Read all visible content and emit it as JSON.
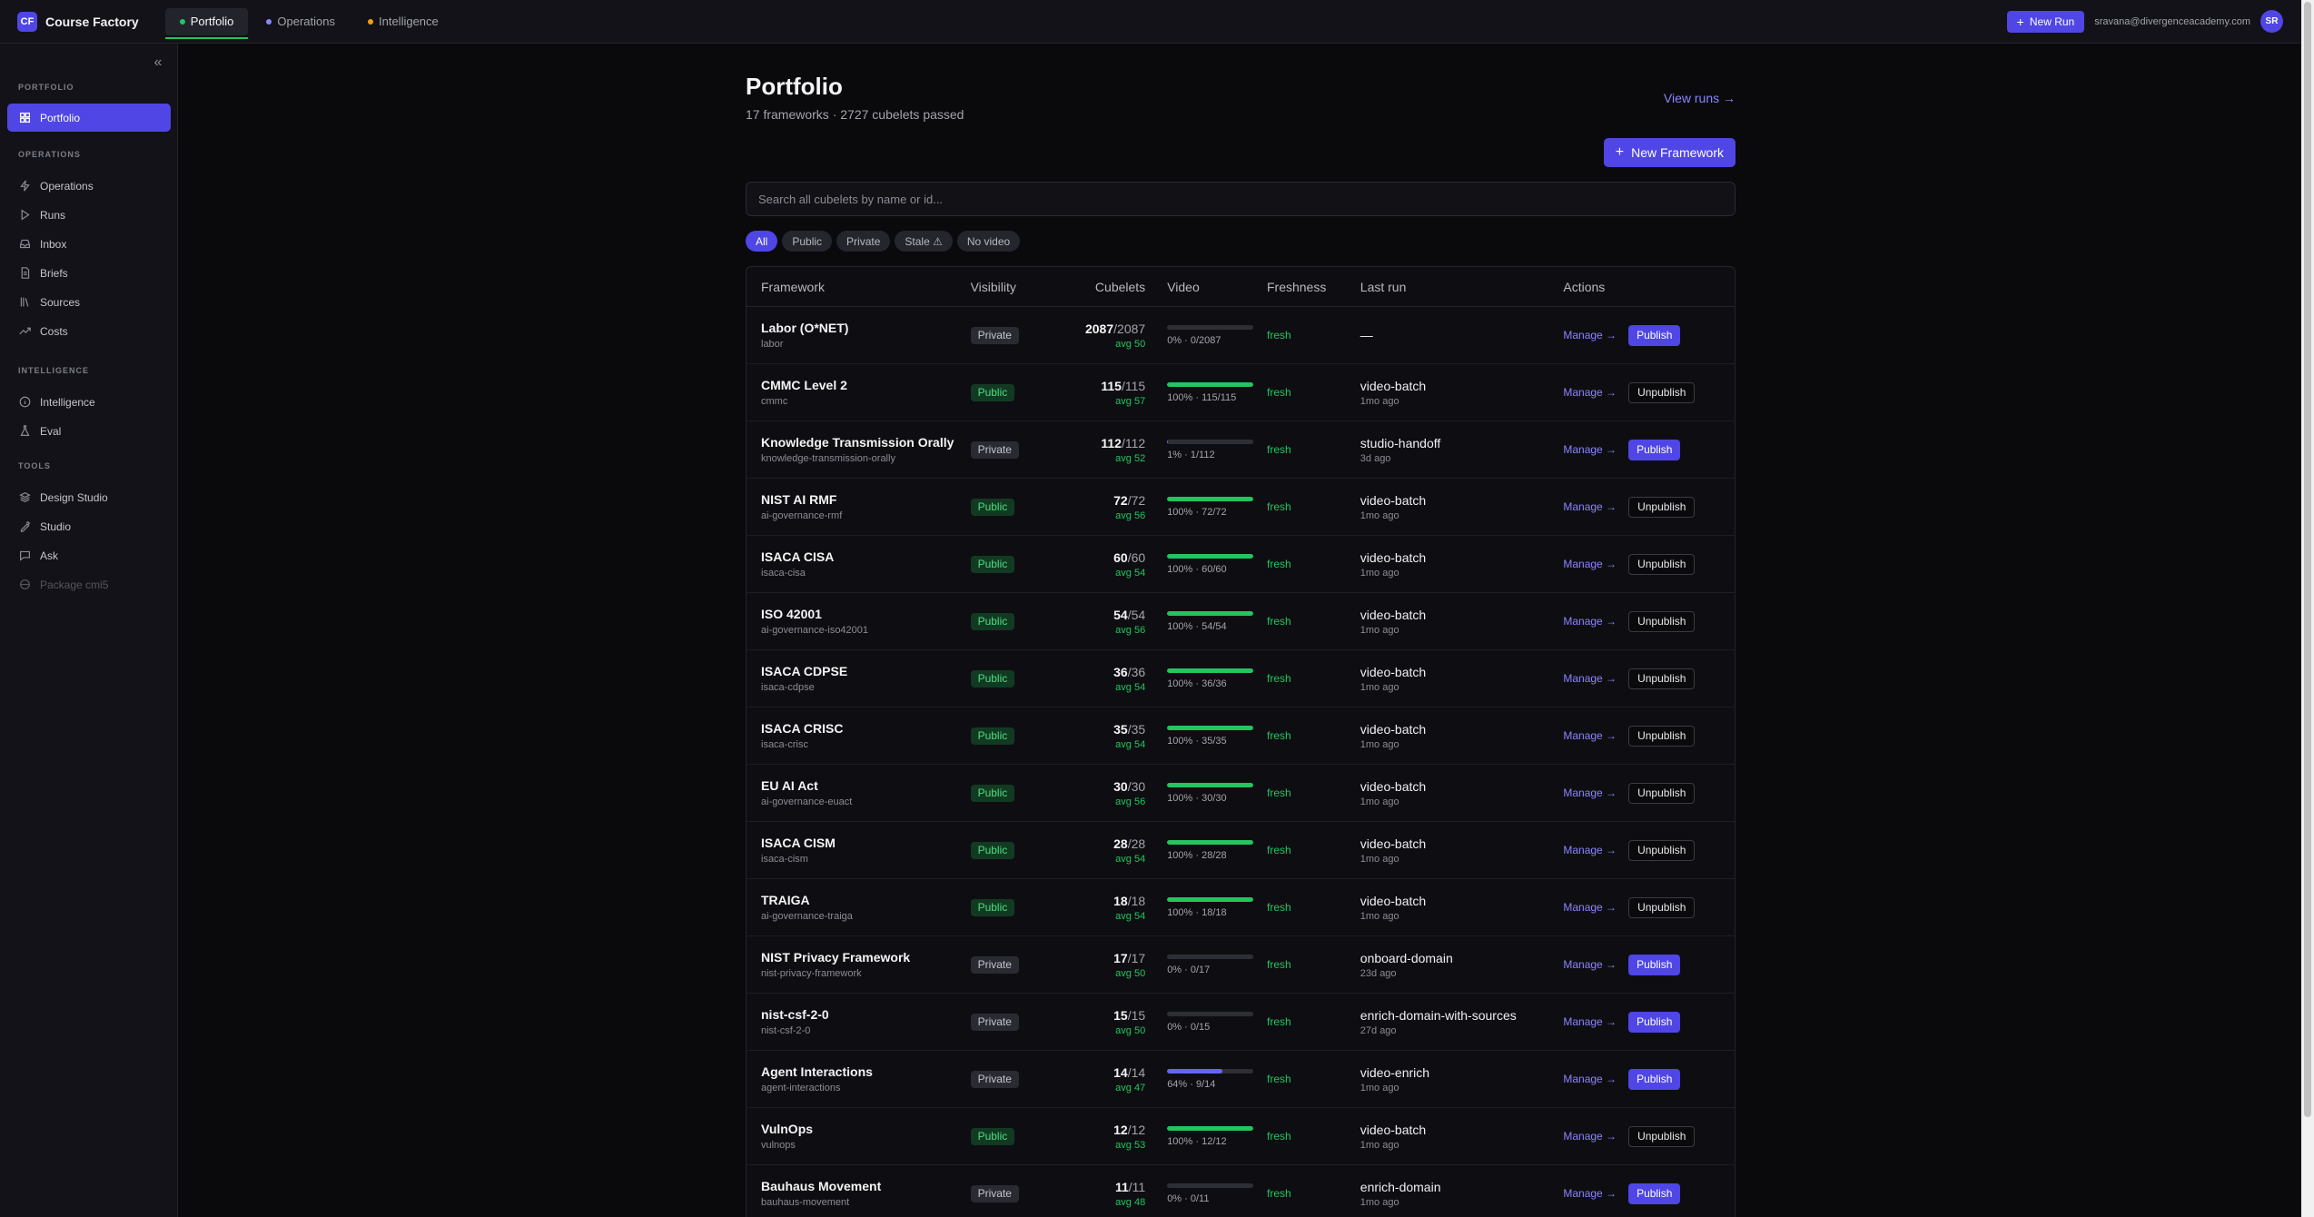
{
  "brand": {
    "logo": "CF",
    "name": "Course Factory"
  },
  "top_tabs": [
    {
      "label": "Portfolio",
      "dot_color": "#22c55e",
      "active": true
    },
    {
      "label": "Operations",
      "dot_color": "#818cf8",
      "active": false
    },
    {
      "label": "Intelligence",
      "dot_color": "#f59e0b",
      "active": false
    }
  ],
  "topbar": {
    "new_run_label": "New Run",
    "user_email": "sravana@divergenceacademy.com",
    "avatar_initials": "SR"
  },
  "sidebar": {
    "sections": [
      {
        "title": "PORTFOLIO",
        "items": [
          {
            "label": "Portfolio",
            "icon": "grid-icon",
            "active": true
          }
        ]
      },
      {
        "title": "OPERATIONS",
        "items": [
          {
            "label": "Operations",
            "icon": "bolt-icon"
          },
          {
            "label": "Runs",
            "icon": "play-icon"
          },
          {
            "label": "Inbox",
            "icon": "inbox-icon"
          },
          {
            "label": "Briefs",
            "icon": "document-icon"
          },
          {
            "label": "Sources",
            "icon": "library-icon"
          },
          {
            "label": "Costs",
            "icon": "trend-icon"
          }
        ]
      },
      {
        "title": "INTELLIGENCE",
        "items": [
          {
            "label": "Intelligence",
            "icon": "info-circle-icon"
          },
          {
            "label": "Eval",
            "icon": "flask-icon"
          }
        ]
      },
      {
        "title": "TOOLS",
        "items": [
          {
            "label": "Design Studio",
            "icon": "layers-icon"
          },
          {
            "label": "Studio",
            "icon": "palette-icon"
          },
          {
            "label": "Ask",
            "icon": "chat-icon"
          },
          {
            "label": "Package cmi5",
            "icon": "package-icon",
            "disabled": true
          }
        ]
      }
    ]
  },
  "page": {
    "title": "Portfolio",
    "subtitle": "17 frameworks · 2727 cubelets passed",
    "view_runs": "View runs →",
    "new_framework": "New Framework",
    "search_placeholder": "Search all cubelets by name or id..."
  },
  "filters": [
    {
      "label": "All",
      "active": true
    },
    {
      "label": "Public"
    },
    {
      "label": "Private"
    },
    {
      "label": "Stale ⚠"
    },
    {
      "label": "No video"
    }
  ],
  "table": {
    "columns": [
      "Framework",
      "Visibility",
      "Cubelets",
      "Video",
      "Freshness",
      "Last run",
      "Actions"
    ],
    "manage_label": "Manage →",
    "rows": [
      {
        "name": "Labor (O*NET)",
        "slug": "labor",
        "visibility": "Private",
        "cub_num": "2087",
        "cub_den": "/2087",
        "avg": "avg 50",
        "video_pct": 0,
        "video_text": "0% · 0/2087",
        "freshness": "fresh",
        "last_run": "—",
        "last_ago": "",
        "action": "Publish"
      },
      {
        "name": "CMMC Level 2",
        "slug": "cmmc",
        "visibility": "Public",
        "cub_num": "115",
        "cub_den": "/115",
        "avg": "avg 57",
        "video_pct": 100,
        "video_text": "100% · 115/115",
        "freshness": "fresh",
        "last_run": "video-batch",
        "last_ago": "1mo ago",
        "action": "Unpublish"
      },
      {
        "name": "Knowledge Transmission Orally",
        "slug": "knowledge-transmission-orally",
        "visibility": "Private",
        "cub_num": "112",
        "cub_den": "/112",
        "avg": "avg 52",
        "video_pct": 1,
        "video_text": "1% · 1/112",
        "freshness": "fresh",
        "last_run": "studio-handoff",
        "last_ago": "3d ago",
        "action": "Publish"
      },
      {
        "name": "NIST AI RMF",
        "slug": "ai-governance-rmf",
        "visibility": "Public",
        "cub_num": "72",
        "cub_den": "/72",
        "avg": "avg 56",
        "video_pct": 100,
        "video_text": "100% · 72/72",
        "freshness": "fresh",
        "last_run": "video-batch",
        "last_ago": "1mo ago",
        "action": "Unpublish"
      },
      {
        "name": "ISACA CISA",
        "slug": "isaca-cisa",
        "visibility": "Public",
        "cub_num": "60",
        "cub_den": "/60",
        "avg": "avg 54",
        "video_pct": 100,
        "video_text": "100% · 60/60",
        "freshness": "fresh",
        "last_run": "video-batch",
        "last_ago": "1mo ago",
        "action": "Unpublish"
      },
      {
        "name": "ISO 42001",
        "slug": "ai-governance-iso42001",
        "visibility": "Public",
        "cub_num": "54",
        "cub_den": "/54",
        "avg": "avg 56",
        "video_pct": 100,
        "video_text": "100% · 54/54",
        "freshness": "fresh",
        "last_run": "video-batch",
        "last_ago": "1mo ago",
        "action": "Unpublish"
      },
      {
        "name": "ISACA CDPSE",
        "slug": "isaca-cdpse",
        "visibility": "Public",
        "cub_num": "36",
        "cub_den": "/36",
        "avg": "avg 54",
        "video_pct": 100,
        "video_text": "100% · 36/36",
        "freshness": "fresh",
        "last_run": "video-batch",
        "last_ago": "1mo ago",
        "action": "Unpublish"
      },
      {
        "name": "ISACA CRISC",
        "slug": "isaca-crisc",
        "visibility": "Public",
        "cub_num": "35",
        "cub_den": "/35",
        "avg": "avg 54",
        "video_pct": 100,
        "video_text": "100% · 35/35",
        "freshness": "fresh",
        "last_run": "video-batch",
        "last_ago": "1mo ago",
        "action": "Unpublish"
      },
      {
        "name": "EU AI Act",
        "slug": "ai-governance-euact",
        "visibility": "Public",
        "cub_num": "30",
        "cub_den": "/30",
        "avg": "avg 56",
        "video_pct": 100,
        "video_text": "100% · 30/30",
        "freshness": "fresh",
        "last_run": "video-batch",
        "last_ago": "1mo ago",
        "action": "Unpublish"
      },
      {
        "name": "ISACA CISM",
        "slug": "isaca-cism",
        "visibility": "Public",
        "cub_num": "28",
        "cub_den": "/28",
        "avg": "avg 54",
        "video_pct": 100,
        "video_text": "100% · 28/28",
        "freshness": "fresh",
        "last_run": "video-batch",
        "last_ago": "1mo ago",
        "action": "Unpublish"
      },
      {
        "name": "TRAIGA",
        "slug": "ai-governance-traiga",
        "visibility": "Public",
        "cub_num": "18",
        "cub_den": "/18",
        "avg": "avg 54",
        "video_pct": 100,
        "video_text": "100% · 18/18",
        "freshness": "fresh",
        "last_run": "video-batch",
        "last_ago": "1mo ago",
        "action": "Unpublish"
      },
      {
        "name": "NIST Privacy Framework",
        "slug": "nist-privacy-framework",
        "visibility": "Private",
        "cub_num": "17",
        "cub_den": "/17",
        "avg": "avg 50",
        "video_pct": 0,
        "video_text": "0% · 0/17",
        "freshness": "fresh",
        "last_run": "onboard-domain",
        "last_ago": "23d ago",
        "action": "Publish"
      },
      {
        "name": "nist-csf-2-0",
        "slug": "nist-csf-2-0",
        "visibility": "Private",
        "cub_num": "15",
        "cub_den": "/15",
        "avg": "avg 50",
        "video_pct": 0,
        "video_text": "0% · 0/15",
        "freshness": "fresh",
        "last_run": "enrich-domain-with-sources",
        "last_ago": "27d ago",
        "action": "Publish"
      },
      {
        "name": "Agent Interactions",
        "slug": "agent-interactions",
        "visibility": "Private",
        "cub_num": "14",
        "cub_den": "/14",
        "avg": "avg 47",
        "video_pct": 64,
        "video_text": "64% · 9/14",
        "freshness": "fresh",
        "last_run": "video-enrich",
        "last_ago": "1mo ago",
        "action": "Publish"
      },
      {
        "name": "VulnOps",
        "slug": "vulnops",
        "visibility": "Public",
        "cub_num": "12",
        "cub_den": "/12",
        "avg": "avg 53",
        "video_pct": 100,
        "video_text": "100% · 12/12",
        "freshness": "fresh",
        "last_run": "video-batch",
        "last_ago": "1mo ago",
        "action": "Unpublish"
      },
      {
        "name": "Bauhaus Movement",
        "slug": "bauhaus-movement",
        "visibility": "Private",
        "cub_num": "11",
        "cub_den": "/11",
        "avg": "avg 48",
        "video_pct": 0,
        "video_text": "0% · 0/11",
        "freshness": "fresh",
        "last_run": "enrich-domain",
        "last_ago": "1mo ago",
        "action": "Publish"
      }
    ]
  },
  "colors": {
    "accent": "#4f46e5",
    "fresh": "#22c55e",
    "partial_video": "#6366f1",
    "background": "#0a0a0c"
  }
}
